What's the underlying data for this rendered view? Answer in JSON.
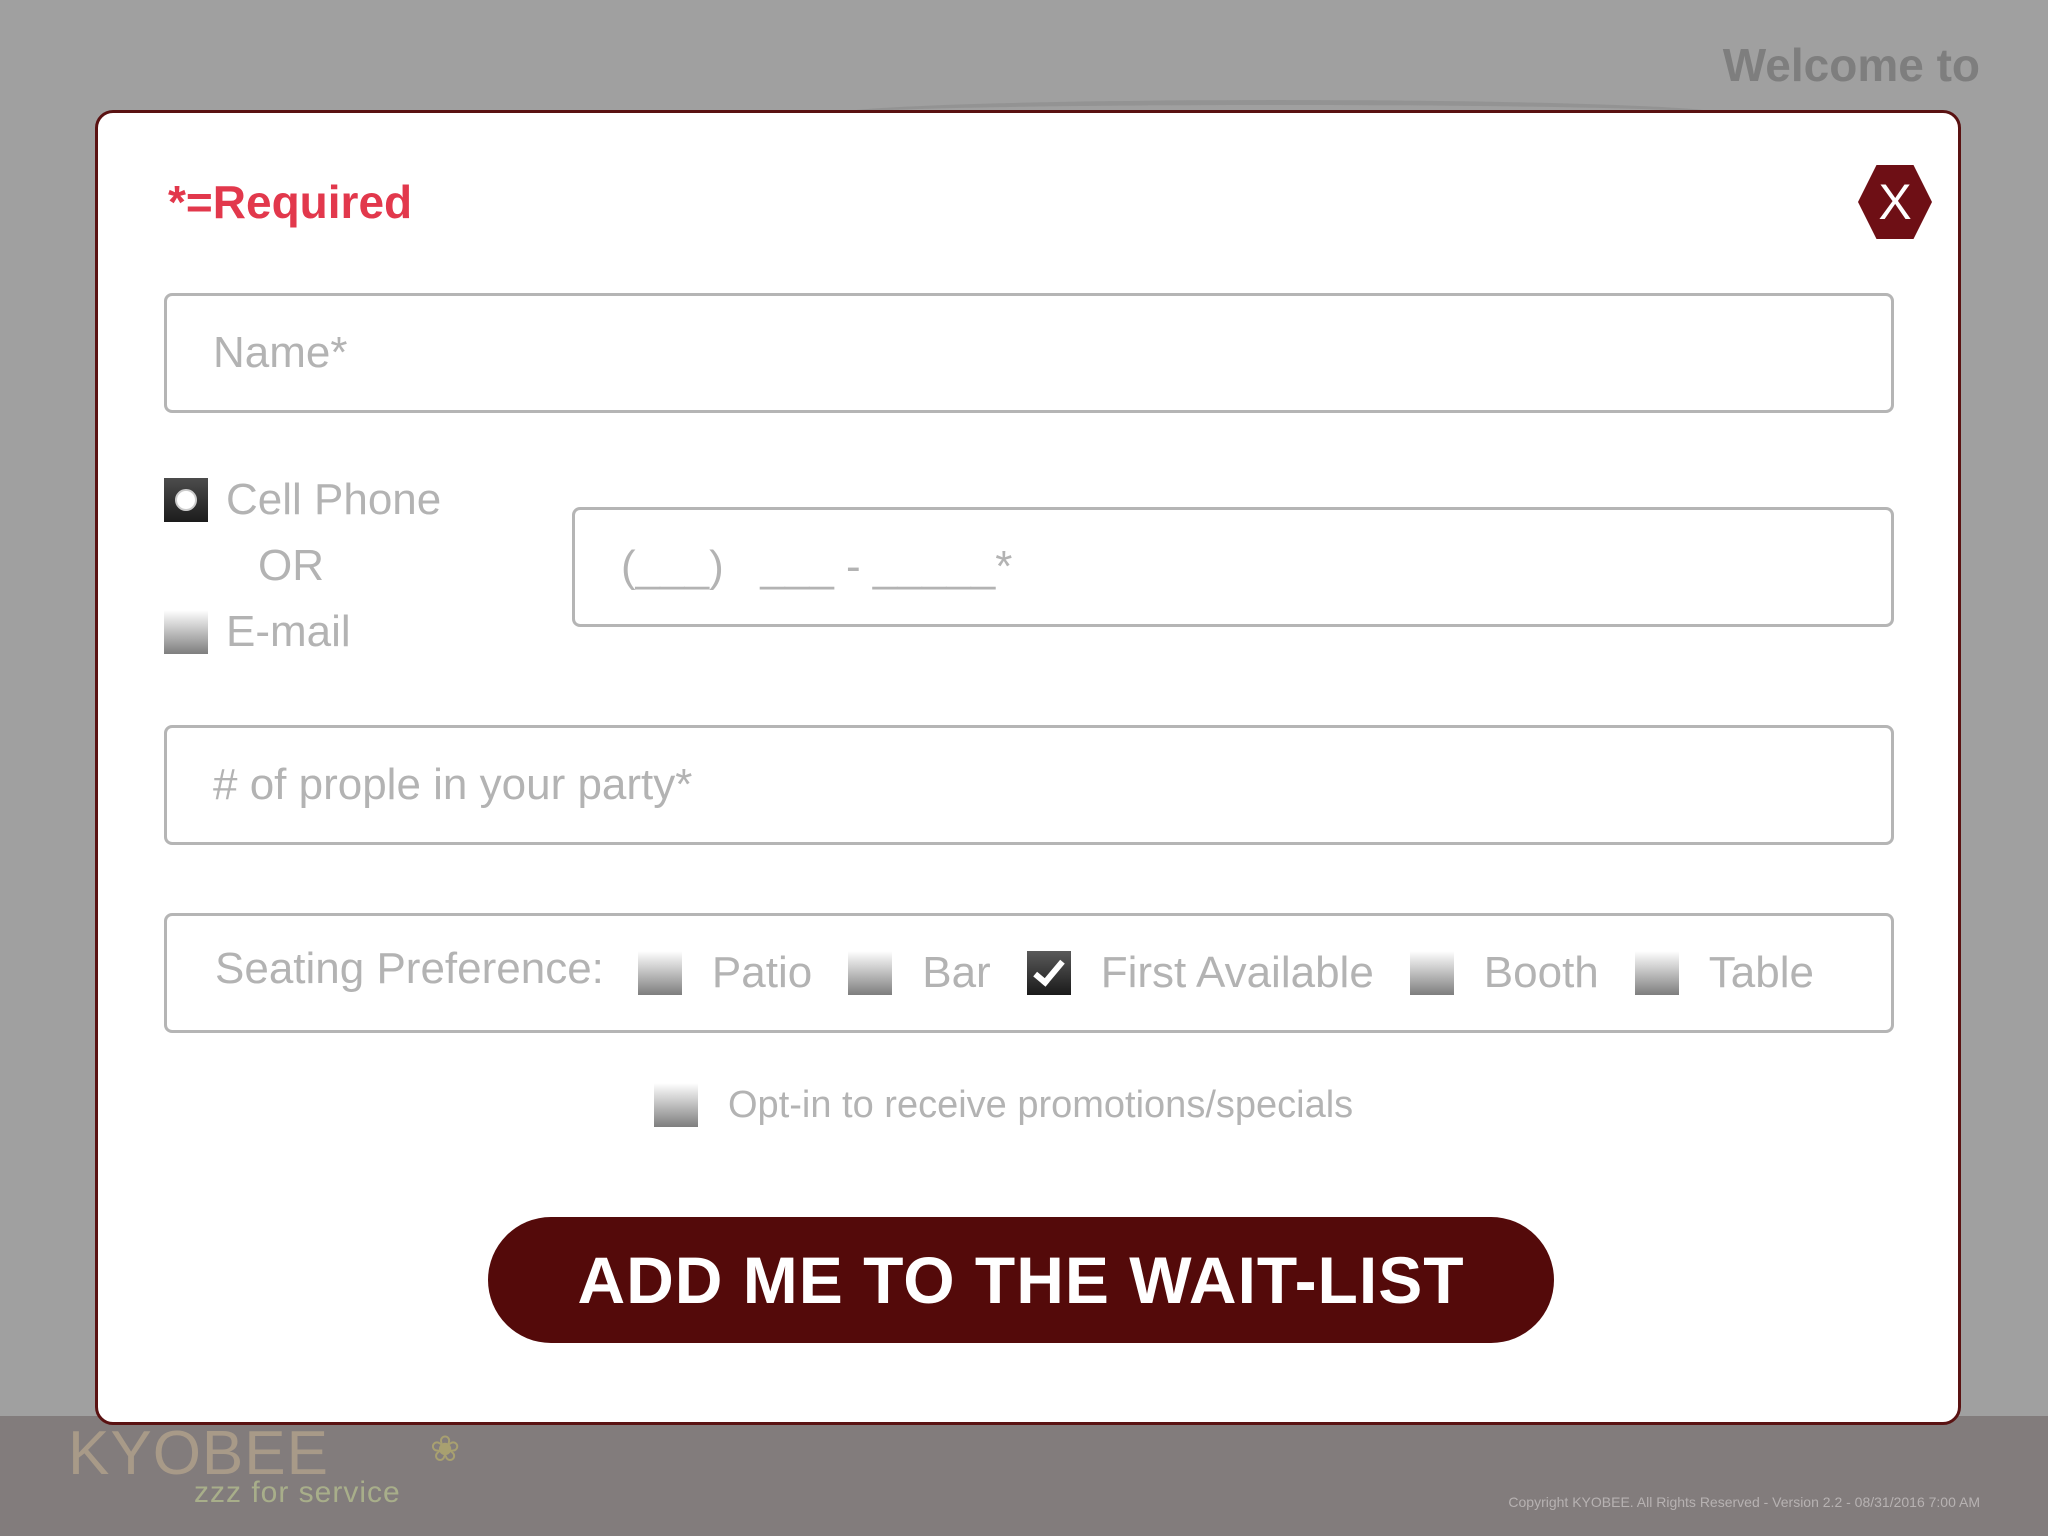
{
  "background": {
    "welcome": "Welcome to",
    "logo_text": "KYOBEE",
    "logo_tagline": "zzz for service",
    "copyright": "Copyright KYOBEE. All Rights Reserved - Version 2.2 - 08/31/2016 7:00 AM"
  },
  "modal": {
    "required_note": "*=Required",
    "close_label": "X",
    "name_placeholder": "Name*",
    "contact": {
      "cell_label": "Cell Phone",
      "or_label": "OR",
      "email_label": "E-mail",
      "selected": "Cell Phone"
    },
    "phone_placeholder": "(___)   ___ - _____*",
    "party_placeholder": "# of prople in your party*",
    "seating": {
      "label": "Seating Preference:",
      "options": [
        {
          "label": "Patio",
          "checked": false
        },
        {
          "label": "Bar",
          "checked": false
        },
        {
          "label": "First Available",
          "checked": true
        },
        {
          "label": "Booth",
          "checked": false
        },
        {
          "label": "Table",
          "checked": false
        }
      ]
    },
    "optin_label": "Opt-in to receive promotions/specials",
    "optin_checked": false,
    "submit_label": "ADD ME TO THE WAIT-LIST"
  },
  "colors": {
    "required_red": "#e2384c",
    "brand_maroon": "#540a0a",
    "close_button": "#6e0f15",
    "overlay_gray": "#a0a0a0"
  }
}
